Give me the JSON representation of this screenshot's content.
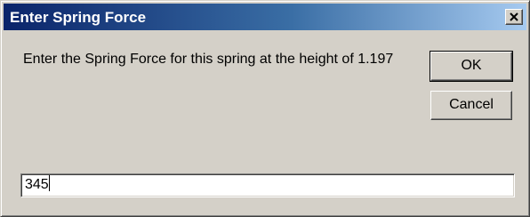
{
  "dialog": {
    "title": "Enter Spring Force",
    "close_icon": "close-icon",
    "message": "Enter the Spring Force for this spring at the height of 1.197",
    "ok_label": "OK",
    "cancel_label": "Cancel",
    "input_value": "345"
  }
}
